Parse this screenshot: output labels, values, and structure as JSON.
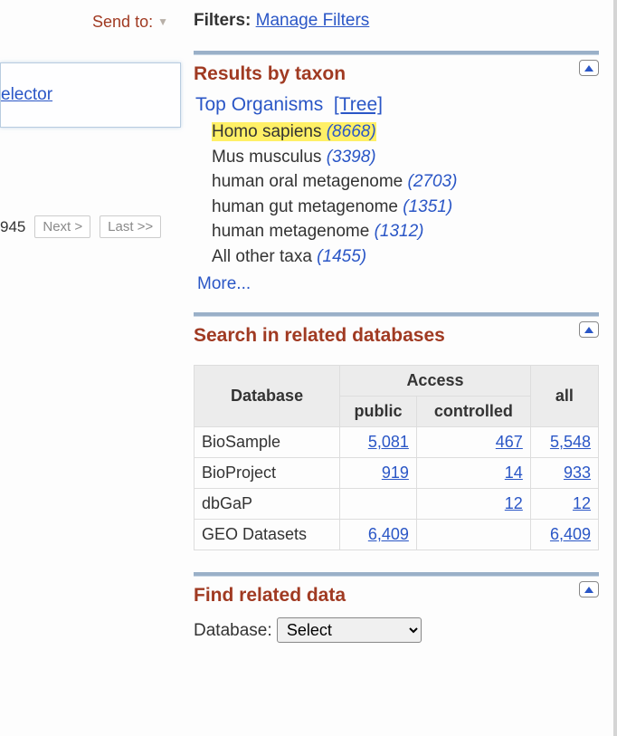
{
  "send_to_label": "Send to:",
  "selector_link": "elector",
  "left_pager": {
    "total": "945",
    "next": "Next >",
    "last": "Last >>"
  },
  "filters": {
    "label": "Filters:",
    "link": "Manage Filters"
  },
  "taxon": {
    "title": "Results by taxon",
    "top_label": "Top Organisms",
    "tree_link": "[Tree]",
    "items": [
      {
        "name": "Homo sapiens",
        "count": "(8668)",
        "highlight": true
      },
      {
        "name": "Mus musculus",
        "count": "(3398)",
        "highlight": false
      },
      {
        "name": "human oral metagenome",
        "count": "(2703)",
        "highlight": false
      },
      {
        "name": "human gut metagenome",
        "count": "(1351)",
        "highlight": false
      },
      {
        "name": "human metagenome",
        "count": "(1312)",
        "highlight": false
      },
      {
        "name": "All other taxa",
        "count": "(1455)",
        "highlight": false
      }
    ],
    "more": "More..."
  },
  "related_db": {
    "title": "Search in related databases",
    "head_db": "Database",
    "head_access": "Access",
    "head_public": "public",
    "head_controlled": "controlled",
    "head_all": "all",
    "rows": [
      {
        "db": "BioSample",
        "public": "5,081",
        "controlled": "467",
        "all": "5,548"
      },
      {
        "db": "BioProject",
        "public": "919",
        "controlled": "14",
        "all": "933"
      },
      {
        "db": "dbGaP",
        "public": "",
        "controlled": "12",
        "all": "12"
      },
      {
        "db": "GEO Datasets",
        "public": "6,409",
        "controlled": "",
        "all": "6,409"
      }
    ]
  },
  "find_related": {
    "title": "Find related data",
    "label": "Database:",
    "select_default": "Select"
  }
}
